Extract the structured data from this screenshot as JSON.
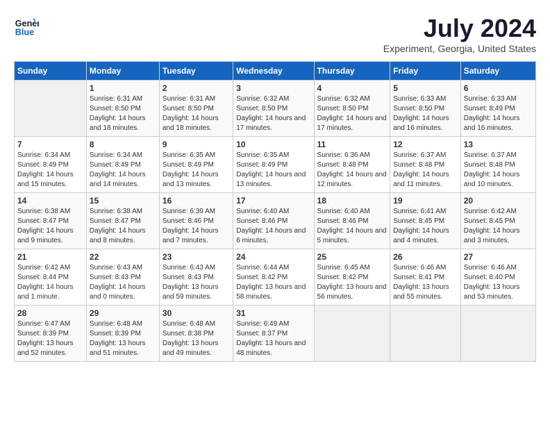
{
  "header": {
    "logo_line1": "General",
    "logo_line2": "Blue",
    "month": "July 2024",
    "location": "Experiment, Georgia, United States"
  },
  "days_of_week": [
    "Sunday",
    "Monday",
    "Tuesday",
    "Wednesday",
    "Thursday",
    "Friday",
    "Saturday"
  ],
  "weeks": [
    [
      {
        "day": "",
        "info": ""
      },
      {
        "day": "1",
        "info": "Sunrise: 6:31 AM\nSunset: 8:50 PM\nDaylight: 14 hours and 18 minutes."
      },
      {
        "day": "2",
        "info": "Sunrise: 6:31 AM\nSunset: 8:50 PM\nDaylight: 14 hours and 18 minutes."
      },
      {
        "day": "3",
        "info": "Sunrise: 6:32 AM\nSunset: 8:50 PM\nDaylight: 14 hours and 17 minutes."
      },
      {
        "day": "4",
        "info": "Sunrise: 6:32 AM\nSunset: 8:50 PM\nDaylight: 14 hours and 17 minutes."
      },
      {
        "day": "5",
        "info": "Sunrise: 6:33 AM\nSunset: 8:50 PM\nDaylight: 14 hours and 16 minutes."
      },
      {
        "day": "6",
        "info": "Sunrise: 6:33 AM\nSunset: 8:49 PM\nDaylight: 14 hours and 16 minutes."
      }
    ],
    [
      {
        "day": "7",
        "info": "Sunrise: 6:34 AM\nSunset: 8:49 PM\nDaylight: 14 hours and 15 minutes."
      },
      {
        "day": "8",
        "info": "Sunrise: 6:34 AM\nSunset: 8:49 PM\nDaylight: 14 hours and 14 minutes."
      },
      {
        "day": "9",
        "info": "Sunrise: 6:35 AM\nSunset: 8:49 PM\nDaylight: 14 hours and 13 minutes."
      },
      {
        "day": "10",
        "info": "Sunrise: 6:35 AM\nSunset: 8:49 PM\nDaylight: 14 hours and 13 minutes."
      },
      {
        "day": "11",
        "info": "Sunrise: 6:36 AM\nSunset: 8:48 PM\nDaylight: 14 hours and 12 minutes."
      },
      {
        "day": "12",
        "info": "Sunrise: 6:37 AM\nSunset: 8:48 PM\nDaylight: 14 hours and 11 minutes."
      },
      {
        "day": "13",
        "info": "Sunrise: 6:37 AM\nSunset: 8:48 PM\nDaylight: 14 hours and 10 minutes."
      }
    ],
    [
      {
        "day": "14",
        "info": "Sunrise: 6:38 AM\nSunset: 8:47 PM\nDaylight: 14 hours and 9 minutes."
      },
      {
        "day": "15",
        "info": "Sunrise: 6:38 AM\nSunset: 8:47 PM\nDaylight: 14 hours and 8 minutes."
      },
      {
        "day": "16",
        "info": "Sunrise: 6:39 AM\nSunset: 8:46 PM\nDaylight: 14 hours and 7 minutes."
      },
      {
        "day": "17",
        "info": "Sunrise: 6:40 AM\nSunset: 8:46 PM\nDaylight: 14 hours and 6 minutes."
      },
      {
        "day": "18",
        "info": "Sunrise: 6:40 AM\nSunset: 8:46 PM\nDaylight: 14 hours and 5 minutes."
      },
      {
        "day": "19",
        "info": "Sunrise: 6:41 AM\nSunset: 8:45 PM\nDaylight: 14 hours and 4 minutes."
      },
      {
        "day": "20",
        "info": "Sunrise: 6:42 AM\nSunset: 8:45 PM\nDaylight: 14 hours and 3 minutes."
      }
    ],
    [
      {
        "day": "21",
        "info": "Sunrise: 6:42 AM\nSunset: 8:44 PM\nDaylight: 14 hours and 1 minute."
      },
      {
        "day": "22",
        "info": "Sunrise: 6:43 AM\nSunset: 8:43 PM\nDaylight: 14 hours and 0 minutes."
      },
      {
        "day": "23",
        "info": "Sunrise: 6:43 AM\nSunset: 8:43 PM\nDaylight: 13 hours and 59 minutes."
      },
      {
        "day": "24",
        "info": "Sunrise: 6:44 AM\nSunset: 8:42 PM\nDaylight: 13 hours and 58 minutes."
      },
      {
        "day": "25",
        "info": "Sunrise: 6:45 AM\nSunset: 8:42 PM\nDaylight: 13 hours and 56 minutes."
      },
      {
        "day": "26",
        "info": "Sunrise: 6:46 AM\nSunset: 8:41 PM\nDaylight: 13 hours and 55 minutes."
      },
      {
        "day": "27",
        "info": "Sunrise: 6:46 AM\nSunset: 8:40 PM\nDaylight: 13 hours and 53 minutes."
      }
    ],
    [
      {
        "day": "28",
        "info": "Sunrise: 6:47 AM\nSunset: 8:39 PM\nDaylight: 13 hours and 52 minutes."
      },
      {
        "day": "29",
        "info": "Sunrise: 6:48 AM\nSunset: 8:39 PM\nDaylight: 13 hours and 51 minutes."
      },
      {
        "day": "30",
        "info": "Sunrise: 6:48 AM\nSunset: 8:38 PM\nDaylight: 13 hours and 49 minutes."
      },
      {
        "day": "31",
        "info": "Sunrise: 6:49 AM\nSunset: 8:37 PM\nDaylight: 13 hours and 48 minutes."
      },
      {
        "day": "",
        "info": ""
      },
      {
        "day": "",
        "info": ""
      },
      {
        "day": "",
        "info": ""
      }
    ]
  ]
}
